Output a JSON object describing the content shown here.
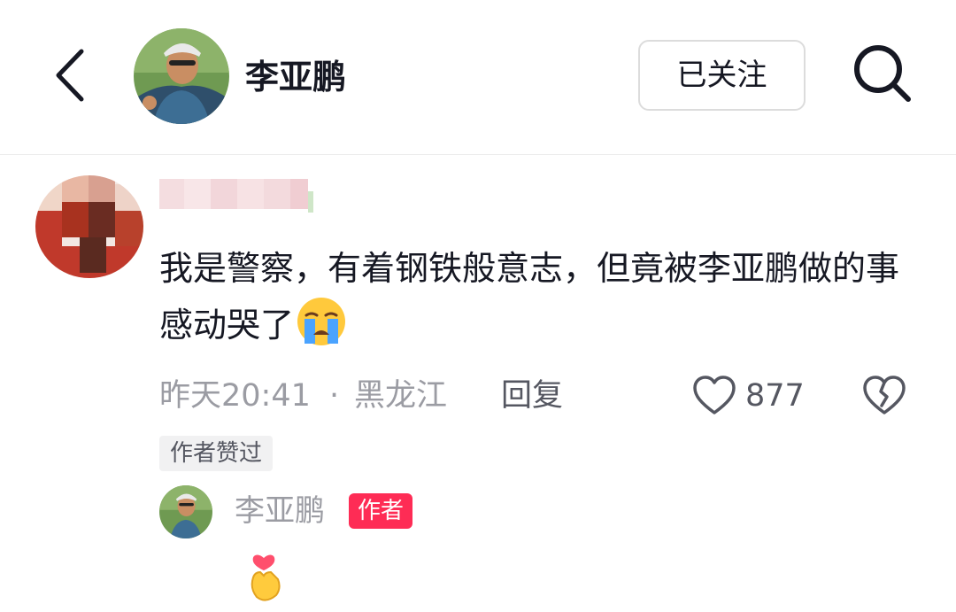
{
  "header": {
    "title": "李亚鹏",
    "follow_label": "已关注",
    "icons": [
      "back-arrow-icon",
      "avatar",
      "search-icon"
    ]
  },
  "comment": {
    "text": "我是警察，有着钢铁般意志，但竟被李亚鹏做的事感动哭了",
    "emoji": "crying-face-emoji",
    "time": "昨天20:41",
    "separator": "·",
    "location": "黑龙江",
    "reply_label": "回复",
    "like_count": "877",
    "author_liked_tag": "作者赞过"
  },
  "author_reply": {
    "name": "李亚鹏",
    "badge": "作者",
    "sticker": "finger-heart-emoji"
  },
  "colors": {
    "text_primary": "#161823",
    "text_secondary": "#9b9ca3",
    "badge_red": "#fe2c55",
    "tag_bg": "#f1f1f2"
  }
}
